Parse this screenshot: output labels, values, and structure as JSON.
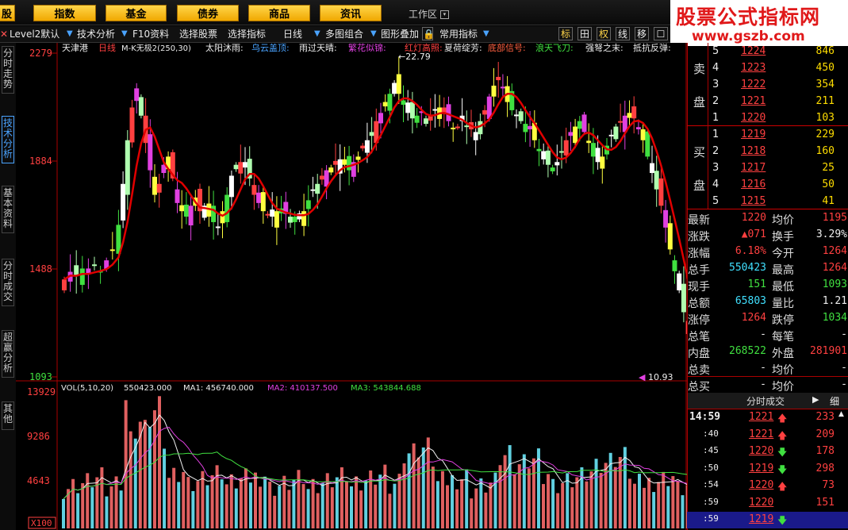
{
  "topnav": {
    "partial": "股",
    "items": [
      "指数",
      "基金",
      "债券",
      "商品",
      "资讯"
    ],
    "workspace": "工作区"
  },
  "watermark": {
    "line1": "股票公式指标网",
    "line2": "www.gszb.com"
  },
  "toolbar": {
    "items": [
      "Level2默认",
      "技术分析",
      "F10资料",
      "选择股票",
      "选择指标",
      "日线",
      "多图组合",
      "图形叠加",
      "常用指标"
    ],
    "icons": [
      "标",
      "田",
      "权",
      "线",
      "移",
      "☐"
    ]
  },
  "lefttabs": [
    "分时走势",
    "技术分析",
    "基本资料",
    "分时成交",
    "超赢分析",
    "其他"
  ],
  "chart": {
    "header": {
      "stock": "天津港",
      "period": "日线",
      "indicator": "M-K无极2(250,30)",
      "tags": [
        "太阳沐雨:",
        "乌云盖顶:",
        "雨过天晴:",
        "繁花似锦:",
        "红灯高照:",
        "夏荷绽芳:",
        "底部信号:",
        "浪天飞刀:",
        "强弩之末:",
        "抵抗反弹:"
      ],
      "tagColors": [
        "#eeeeee",
        "#4aa3ff",
        "#eeeeee",
        "#e040e0",
        "#ff4040",
        "#eeeeee",
        "#ff6040",
        "#40e040",
        "#eeeeee",
        "#eeeeee"
      ]
    },
    "yAxis": [
      "2279",
      "1884",
      "1488",
      "1093"
    ],
    "highLabel": "22.79",
    "lowLabel": "10.93",
    "vol": {
      "label": "VOL(5,10,20)",
      "v": "550423.000",
      "ma1": "MA1: 456740.000",
      "ma2": "MA2: 410137.500",
      "ma3": "MA3: 543844.688",
      "yAxis": [
        "13929",
        "9286",
        "4643"
      ],
      "unit": "X100"
    }
  },
  "orderbook": {
    "sell": [
      {
        "n": "5",
        "price": "1224",
        "vol": "846"
      },
      {
        "n": "4",
        "price": "1223",
        "vol": "450"
      },
      {
        "n": "3",
        "price": "1222",
        "vol": "354"
      },
      {
        "n": "2",
        "price": "1221",
        "vol": "211"
      },
      {
        "n": "1",
        "price": "1220",
        "vol": "103"
      }
    ],
    "sellLabel": [
      "卖",
      "盘"
    ],
    "buy": [
      {
        "n": "1",
        "price": "1219",
        "vol": "229"
      },
      {
        "n": "2",
        "price": "1218",
        "vol": "160"
      },
      {
        "n": "3",
        "price": "1217",
        "vol": "25"
      },
      {
        "n": "4",
        "price": "1216",
        "vol": "50"
      },
      {
        "n": "5",
        "price": "1215",
        "vol": "41"
      }
    ],
    "buyLabel": [
      "买",
      "盘"
    ]
  },
  "stats": [
    {
      "l1": "最新",
      "v1": "1220",
      "l2": "均价",
      "v2": "1195"
    },
    {
      "l1": "涨跌",
      "v1": "▲071",
      "l2": "换手",
      "v2": "3.29%"
    },
    {
      "l1": "涨幅",
      "v1": "6.18%",
      "l2": "今开",
      "v2": "1264"
    },
    {
      "l1": "总手",
      "v1": "550423",
      "l2": "最高",
      "v2": "1264"
    },
    {
      "l1": "现手",
      "v1": "151",
      "l2": "最低",
      "v2": "1093"
    },
    {
      "l1": "总额",
      "v1": "65803",
      "l2": "量比",
      "v2": "1.21"
    },
    {
      "l1": "涨停",
      "v1": "1264",
      "l2": "跌停",
      "v2": "1034"
    },
    {
      "l1": "总笔",
      "v1": "-",
      "l2": "每笔",
      "v2": "-"
    },
    {
      "l1": "内盘",
      "v1": "268522",
      "l2": "外盘",
      "v2": "281901"
    },
    {
      "l1": "总卖",
      "v1": "-",
      "l2": "均价",
      "v2": "-"
    },
    {
      "l1": "总买",
      "v1": "-",
      "l2": "均价",
      "v2": "-"
    }
  ],
  "ticks": {
    "tab": "分时成交",
    "detail": "细",
    "rows": [
      {
        "t": "14:59",
        "p": "1221",
        "dir": "up",
        "v": "233"
      },
      {
        "t": ":40",
        "p": "1221",
        "dir": "up",
        "v": "209"
      },
      {
        "t": ":45",
        "p": "1220",
        "dir": "down",
        "v": "178"
      },
      {
        "t": ":50",
        "p": "1219",
        "dir": "down",
        "v": "298"
      },
      {
        "t": ":54",
        "p": "1220",
        "dir": "up",
        "v": "73"
      },
      {
        "t": ":59",
        "p": "1220",
        "dir": "",
        "v": "151"
      },
      {
        "t": ":59",
        "p": "1219",
        "dir": "down",
        "v": ""
      }
    ]
  },
  "colors": {
    "up": "#ff4040",
    "down": "#40e040",
    "ma": "#e00000",
    "vol_up": "#e06060",
    "vol_down": "#60d0e0"
  }
}
